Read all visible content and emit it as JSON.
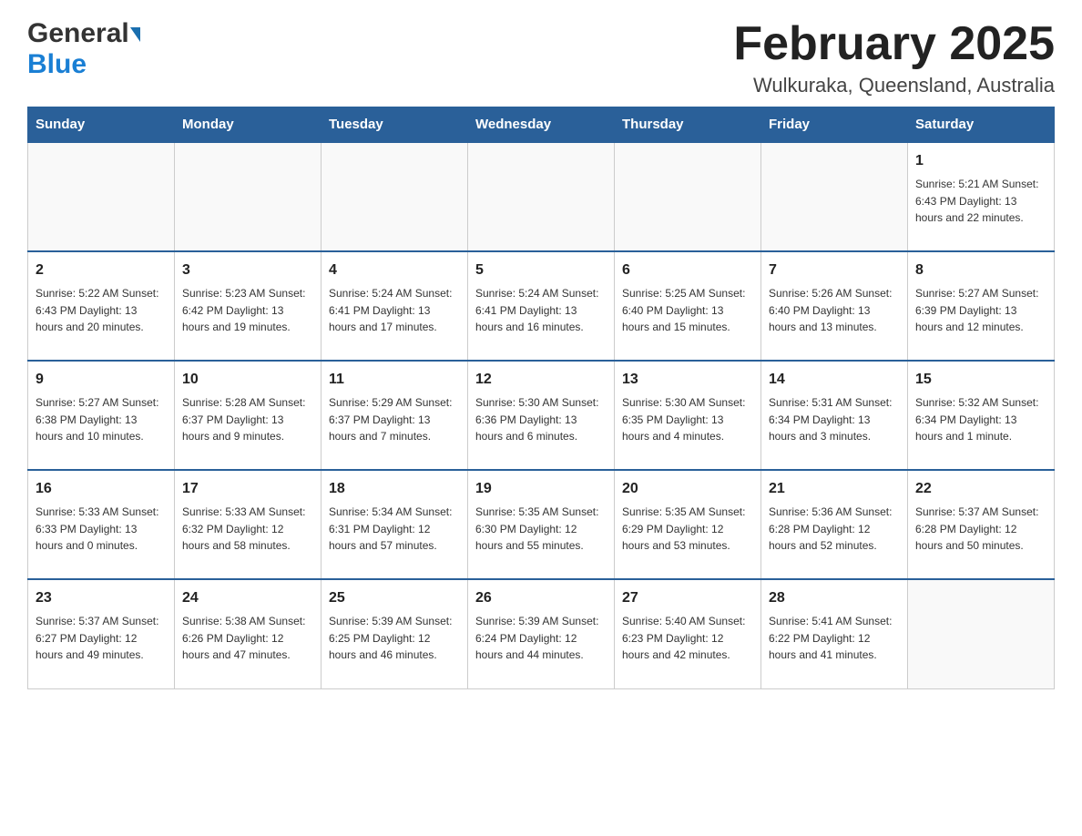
{
  "header": {
    "logo_general": "General",
    "logo_blue": "Blue",
    "month_title": "February 2025",
    "location": "Wulkuraka, Queensland, Australia"
  },
  "days_of_week": [
    "Sunday",
    "Monday",
    "Tuesday",
    "Wednesday",
    "Thursday",
    "Friday",
    "Saturday"
  ],
  "weeks": [
    [
      {
        "day": "",
        "info": ""
      },
      {
        "day": "",
        "info": ""
      },
      {
        "day": "",
        "info": ""
      },
      {
        "day": "",
        "info": ""
      },
      {
        "day": "",
        "info": ""
      },
      {
        "day": "",
        "info": ""
      },
      {
        "day": "1",
        "info": "Sunrise: 5:21 AM\nSunset: 6:43 PM\nDaylight: 13 hours and 22 minutes."
      }
    ],
    [
      {
        "day": "2",
        "info": "Sunrise: 5:22 AM\nSunset: 6:43 PM\nDaylight: 13 hours and 20 minutes."
      },
      {
        "day": "3",
        "info": "Sunrise: 5:23 AM\nSunset: 6:42 PM\nDaylight: 13 hours and 19 minutes."
      },
      {
        "day": "4",
        "info": "Sunrise: 5:24 AM\nSunset: 6:41 PM\nDaylight: 13 hours and 17 minutes."
      },
      {
        "day": "5",
        "info": "Sunrise: 5:24 AM\nSunset: 6:41 PM\nDaylight: 13 hours and 16 minutes."
      },
      {
        "day": "6",
        "info": "Sunrise: 5:25 AM\nSunset: 6:40 PM\nDaylight: 13 hours and 15 minutes."
      },
      {
        "day": "7",
        "info": "Sunrise: 5:26 AM\nSunset: 6:40 PM\nDaylight: 13 hours and 13 minutes."
      },
      {
        "day": "8",
        "info": "Sunrise: 5:27 AM\nSunset: 6:39 PM\nDaylight: 13 hours and 12 minutes."
      }
    ],
    [
      {
        "day": "9",
        "info": "Sunrise: 5:27 AM\nSunset: 6:38 PM\nDaylight: 13 hours and 10 minutes."
      },
      {
        "day": "10",
        "info": "Sunrise: 5:28 AM\nSunset: 6:37 PM\nDaylight: 13 hours and 9 minutes."
      },
      {
        "day": "11",
        "info": "Sunrise: 5:29 AM\nSunset: 6:37 PM\nDaylight: 13 hours and 7 minutes."
      },
      {
        "day": "12",
        "info": "Sunrise: 5:30 AM\nSunset: 6:36 PM\nDaylight: 13 hours and 6 minutes."
      },
      {
        "day": "13",
        "info": "Sunrise: 5:30 AM\nSunset: 6:35 PM\nDaylight: 13 hours and 4 minutes."
      },
      {
        "day": "14",
        "info": "Sunrise: 5:31 AM\nSunset: 6:34 PM\nDaylight: 13 hours and 3 minutes."
      },
      {
        "day": "15",
        "info": "Sunrise: 5:32 AM\nSunset: 6:34 PM\nDaylight: 13 hours and 1 minute."
      }
    ],
    [
      {
        "day": "16",
        "info": "Sunrise: 5:33 AM\nSunset: 6:33 PM\nDaylight: 13 hours and 0 minutes."
      },
      {
        "day": "17",
        "info": "Sunrise: 5:33 AM\nSunset: 6:32 PM\nDaylight: 12 hours and 58 minutes."
      },
      {
        "day": "18",
        "info": "Sunrise: 5:34 AM\nSunset: 6:31 PM\nDaylight: 12 hours and 57 minutes."
      },
      {
        "day": "19",
        "info": "Sunrise: 5:35 AM\nSunset: 6:30 PM\nDaylight: 12 hours and 55 minutes."
      },
      {
        "day": "20",
        "info": "Sunrise: 5:35 AM\nSunset: 6:29 PM\nDaylight: 12 hours and 53 minutes."
      },
      {
        "day": "21",
        "info": "Sunrise: 5:36 AM\nSunset: 6:28 PM\nDaylight: 12 hours and 52 minutes."
      },
      {
        "day": "22",
        "info": "Sunrise: 5:37 AM\nSunset: 6:28 PM\nDaylight: 12 hours and 50 minutes."
      }
    ],
    [
      {
        "day": "23",
        "info": "Sunrise: 5:37 AM\nSunset: 6:27 PM\nDaylight: 12 hours and 49 minutes."
      },
      {
        "day": "24",
        "info": "Sunrise: 5:38 AM\nSunset: 6:26 PM\nDaylight: 12 hours and 47 minutes."
      },
      {
        "day": "25",
        "info": "Sunrise: 5:39 AM\nSunset: 6:25 PM\nDaylight: 12 hours and 46 minutes."
      },
      {
        "day": "26",
        "info": "Sunrise: 5:39 AM\nSunset: 6:24 PM\nDaylight: 12 hours and 44 minutes."
      },
      {
        "day": "27",
        "info": "Sunrise: 5:40 AM\nSunset: 6:23 PM\nDaylight: 12 hours and 42 minutes."
      },
      {
        "day": "28",
        "info": "Sunrise: 5:41 AM\nSunset: 6:22 PM\nDaylight: 12 hours and 41 minutes."
      },
      {
        "day": "",
        "info": ""
      }
    ]
  ]
}
